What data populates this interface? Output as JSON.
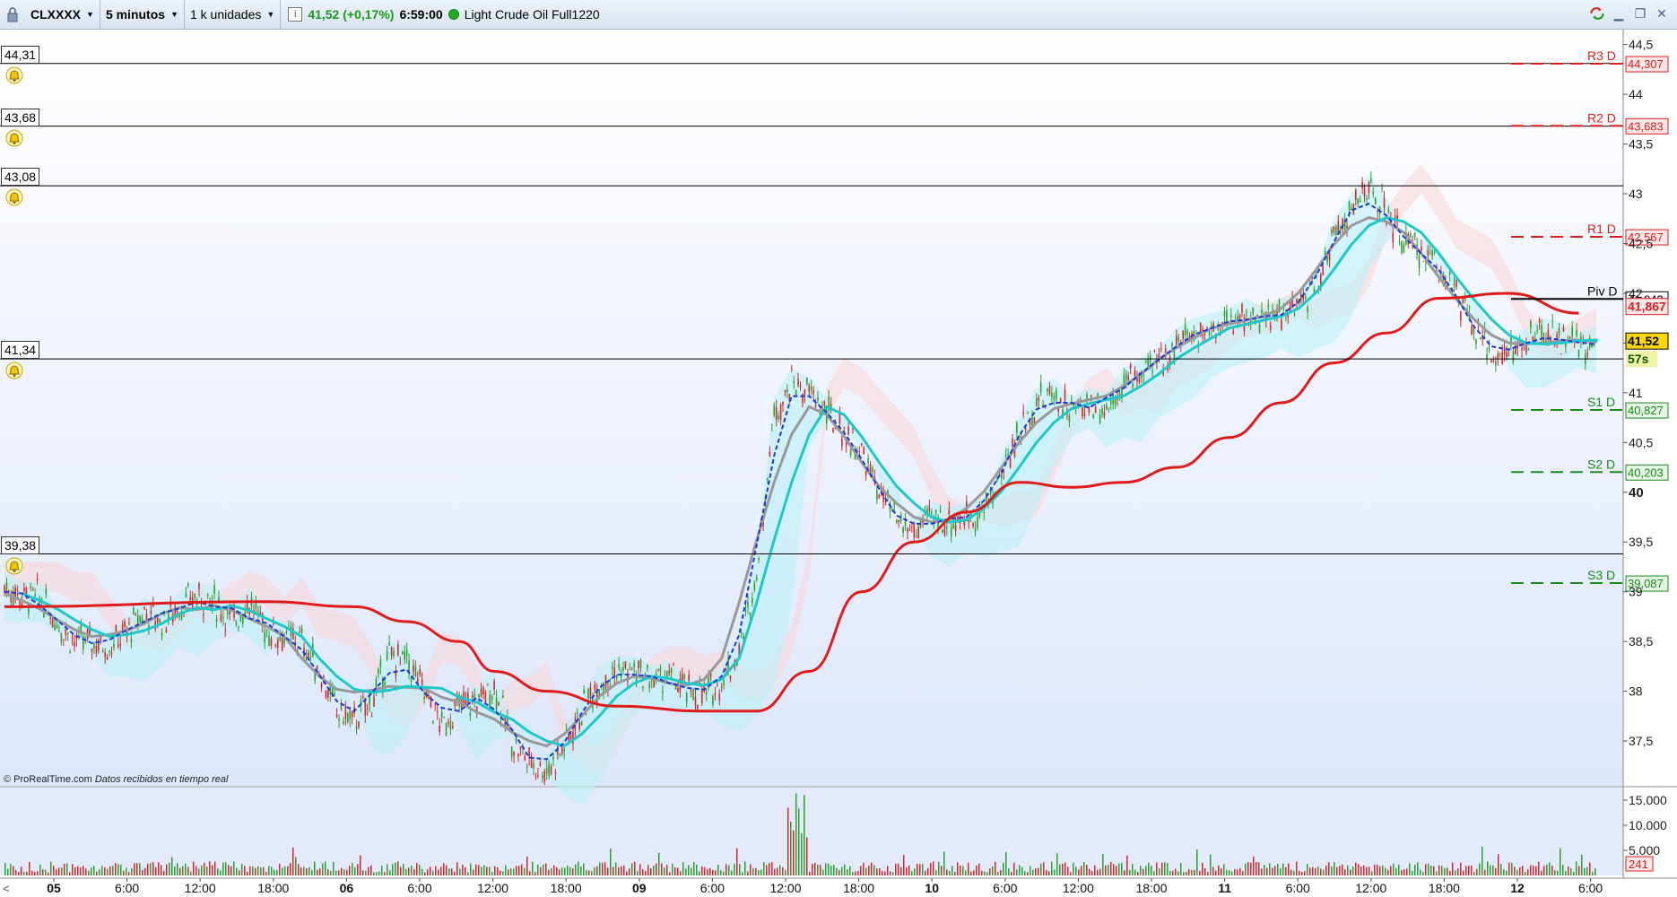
{
  "toolbar": {
    "symbol": "CLXXXX",
    "timeframe": "5 minutos",
    "units": "1 k unidades",
    "info": "i",
    "price_change": "41,52 (+0,17%)",
    "time": "6:59:00",
    "instrument": "Light Crude Oil Full1220"
  },
  "credit": {
    "brand": "© ProRealTime.com",
    "note": "Datos recibidos en tiempo real"
  },
  "alert_levels": [
    "44,31",
    "43,68",
    "43,08",
    "41,34",
    "39,38"
  ],
  "alert_level_values": [
    44.31,
    43.68,
    43.08,
    41.34,
    39.38
  ],
  "pivot_levels": [
    {
      "name": "R3 D",
      "value": "44,307",
      "v": 44.307,
      "color": "#e01b1b",
      "bg": "#fde8e8"
    },
    {
      "name": "R2 D",
      "value": "43,683",
      "v": 43.683,
      "color": "#e01b1b",
      "bg": "#fde8e8"
    },
    {
      "name": "R1 D",
      "value": "42,567",
      "v": 42.567,
      "color": "#e01b1b",
      "bg": "#fde8e8"
    },
    {
      "name": "Piv D",
      "value": "41,943",
      "v": 41.943,
      "color": "#000000",
      "bg": "#ffffff"
    },
    {
      "name": "S1 D",
      "value": "40,827",
      "v": 40.827,
      "color": "#1a8a1a",
      "bg": "#e6f6e6"
    },
    {
      "name": "S2 D",
      "value": "40,203",
      "v": 40.203,
      "color": "#1a8a1a",
      "bg": "#e6f6e6"
    },
    {
      "name": "S3 D",
      "value": "39,087",
      "v": 39.087,
      "color": "#1a8a1a",
      "bg": "#e6f6e6"
    }
  ],
  "price_tags": [
    {
      "value": "41,867",
      "v": 41.867,
      "color": "#e01b1b",
      "bg": "#fde8e8"
    },
    {
      "value": "41,52",
      "v": 41.52,
      "color": "#000000",
      "bg": "#ffd700"
    }
  ],
  "countdown": "57s",
  "colors": {
    "up": "#2ea02e",
    "down": "#d62828",
    "ma_red": "#e01b1b",
    "ma_cyan": "#1fc7c7",
    "ma_grey": "#999999",
    "ma_blue": "#1a3bd6",
    "cloud_cyan": "#b8f0f7",
    "cloud_pink": "#f9d6d6"
  },
  "chart_data": {
    "type": "candlestick",
    "y_ticks": [
      "44,5",
      "44",
      "43,5",
      "43",
      "42,5",
      "42",
      "41,5",
      "41",
      "40,5",
      "40",
      "39,5",
      "39",
      "38,5",
      "38",
      "37,5"
    ],
    "y_tick_values": [
      44.5,
      44,
      43.5,
      43,
      42.5,
      42,
      41.5,
      41,
      40.5,
      40,
      39.5,
      39,
      38.5,
      38,
      37.5
    ],
    "ylim": [
      37.05,
      44.65
    ],
    "bold_ticks": [
      "40"
    ],
    "x_ticks": [
      "05",
      "6:00",
      "12:00",
      "18:00",
      "06",
      "6:00",
      "12:00",
      "18:00",
      "09",
      "6:00",
      "12:00",
      "18:00",
      "10",
      "6:00",
      "12:00",
      "18:00",
      "11",
      "6:00",
      "12:00",
      "18:00",
      "12",
      "6:00"
    ],
    "bold_x_ticks": [
      "05",
      "06",
      "09",
      "10",
      "11",
      "12"
    ],
    "price_path": [
      39.05,
      38.95,
      38.95,
      38.7,
      38.5,
      38.5,
      38.45,
      38.6,
      38.8,
      38.7,
      38.85,
      38.95,
      38.9,
      38.7,
      38.9,
      38.6,
      38.55,
      38.5,
      38.2,
      37.8,
      37.7,
      37.9,
      38.35,
      38.3,
      38.0,
      37.65,
      37.85,
      37.9,
      38.05,
      37.5,
      37.3,
      37.2,
      37.45,
      37.8,
      38.1,
      38.2,
      38.2,
      38.1,
      38.15,
      38.0,
      37.95,
      38.1,
      38.4,
      39.2,
      40.8,
      41.1,
      41.0,
      40.8,
      40.6,
      40.4,
      40.0,
      39.7,
      39.6,
      39.75,
      39.7,
      39.75,
      39.8,
      40.2,
      40.6,
      40.9,
      41.0,
      40.8,
      40.9,
      40.85,
      41.1,
      41.2,
      41.3,
      41.5,
      41.6,
      41.65,
      41.7,
      41.8,
      41.7,
      41.8,
      41.85,
      42.1,
      42.6,
      42.85,
      43.05,
      42.8,
      42.5,
      42.4,
      42.3,
      42.0,
      41.6,
      41.4,
      41.4,
      41.5,
      41.6,
      41.55,
      41.45,
      41.52
    ],
    "ma_red": [
      [
        0,
        38.85
      ],
      [
        15,
        38.9
      ],
      [
        20,
        38.85
      ],
      [
        23,
        38.7
      ],
      [
        26,
        38.5
      ],
      [
        28,
        38.2
      ],
      [
        31,
        38.0
      ],
      [
        35,
        37.85
      ],
      [
        40,
        37.8
      ],
      [
        43,
        37.8
      ],
      [
        46,
        38.2
      ],
      [
        49,
        39.0
      ],
      [
        52,
        39.5
      ],
      [
        55,
        39.8
      ],
      [
        58,
        40.1
      ],
      [
        61,
        40.05
      ],
      [
        64,
        40.1
      ],
      [
        67,
        40.25
      ],
      [
        70,
        40.55
      ],
      [
        73,
        40.9
      ],
      [
        76,
        41.3
      ],
      [
        79,
        41.6
      ],
      [
        82,
        41.95
      ],
      [
        86,
        42.0
      ],
      [
        90,
        41.8
      ]
    ],
    "volume_ticks": [
      "15.000",
      "10.000",
      "5.000"
    ],
    "volume_tick_values": [
      15000,
      10000,
      5000
    ],
    "volume_ylim": [
      0,
      17500
    ],
    "volume_last": "241"
  }
}
